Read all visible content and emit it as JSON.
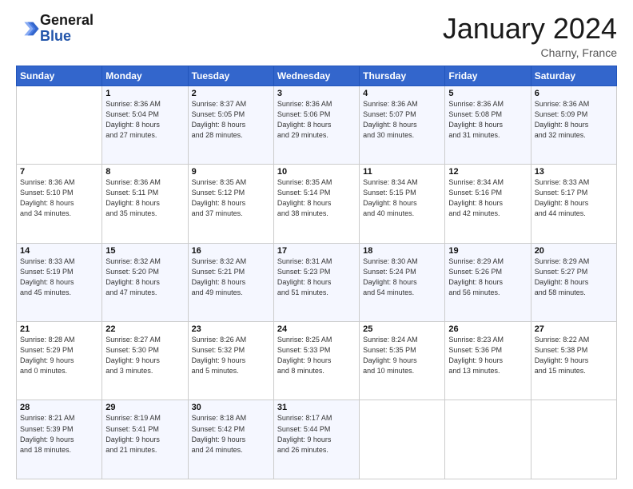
{
  "logo": {
    "line1": "General",
    "line2": "Blue"
  },
  "header": {
    "title": "January 2024",
    "subtitle": "Charny, France"
  },
  "days_of_week": [
    "Sunday",
    "Monday",
    "Tuesday",
    "Wednesday",
    "Thursday",
    "Friday",
    "Saturday"
  ],
  "weeks": [
    [
      {
        "day": "",
        "info": ""
      },
      {
        "day": "1",
        "info": "Sunrise: 8:36 AM\nSunset: 5:04 PM\nDaylight: 8 hours\nand 27 minutes."
      },
      {
        "day": "2",
        "info": "Sunrise: 8:37 AM\nSunset: 5:05 PM\nDaylight: 8 hours\nand 28 minutes."
      },
      {
        "day": "3",
        "info": "Sunrise: 8:36 AM\nSunset: 5:06 PM\nDaylight: 8 hours\nand 29 minutes."
      },
      {
        "day": "4",
        "info": "Sunrise: 8:36 AM\nSunset: 5:07 PM\nDaylight: 8 hours\nand 30 minutes."
      },
      {
        "day": "5",
        "info": "Sunrise: 8:36 AM\nSunset: 5:08 PM\nDaylight: 8 hours\nand 31 minutes."
      },
      {
        "day": "6",
        "info": "Sunrise: 8:36 AM\nSunset: 5:09 PM\nDaylight: 8 hours\nand 32 minutes."
      }
    ],
    [
      {
        "day": "7",
        "info": "Sunrise: 8:36 AM\nSunset: 5:10 PM\nDaylight: 8 hours\nand 34 minutes."
      },
      {
        "day": "8",
        "info": "Sunrise: 8:36 AM\nSunset: 5:11 PM\nDaylight: 8 hours\nand 35 minutes."
      },
      {
        "day": "9",
        "info": "Sunrise: 8:35 AM\nSunset: 5:12 PM\nDaylight: 8 hours\nand 37 minutes."
      },
      {
        "day": "10",
        "info": "Sunrise: 8:35 AM\nSunset: 5:14 PM\nDaylight: 8 hours\nand 38 minutes."
      },
      {
        "day": "11",
        "info": "Sunrise: 8:34 AM\nSunset: 5:15 PM\nDaylight: 8 hours\nand 40 minutes."
      },
      {
        "day": "12",
        "info": "Sunrise: 8:34 AM\nSunset: 5:16 PM\nDaylight: 8 hours\nand 42 minutes."
      },
      {
        "day": "13",
        "info": "Sunrise: 8:33 AM\nSunset: 5:17 PM\nDaylight: 8 hours\nand 44 minutes."
      }
    ],
    [
      {
        "day": "14",
        "info": "Sunrise: 8:33 AM\nSunset: 5:19 PM\nDaylight: 8 hours\nand 45 minutes."
      },
      {
        "day": "15",
        "info": "Sunrise: 8:32 AM\nSunset: 5:20 PM\nDaylight: 8 hours\nand 47 minutes."
      },
      {
        "day": "16",
        "info": "Sunrise: 8:32 AM\nSunset: 5:21 PM\nDaylight: 8 hours\nand 49 minutes."
      },
      {
        "day": "17",
        "info": "Sunrise: 8:31 AM\nSunset: 5:23 PM\nDaylight: 8 hours\nand 51 minutes."
      },
      {
        "day": "18",
        "info": "Sunrise: 8:30 AM\nSunset: 5:24 PM\nDaylight: 8 hours\nand 54 minutes."
      },
      {
        "day": "19",
        "info": "Sunrise: 8:29 AM\nSunset: 5:26 PM\nDaylight: 8 hours\nand 56 minutes."
      },
      {
        "day": "20",
        "info": "Sunrise: 8:29 AM\nSunset: 5:27 PM\nDaylight: 8 hours\nand 58 minutes."
      }
    ],
    [
      {
        "day": "21",
        "info": "Sunrise: 8:28 AM\nSunset: 5:29 PM\nDaylight: 9 hours\nand 0 minutes."
      },
      {
        "day": "22",
        "info": "Sunrise: 8:27 AM\nSunset: 5:30 PM\nDaylight: 9 hours\nand 3 minutes."
      },
      {
        "day": "23",
        "info": "Sunrise: 8:26 AM\nSunset: 5:32 PM\nDaylight: 9 hours\nand 5 minutes."
      },
      {
        "day": "24",
        "info": "Sunrise: 8:25 AM\nSunset: 5:33 PM\nDaylight: 9 hours\nand 8 minutes."
      },
      {
        "day": "25",
        "info": "Sunrise: 8:24 AM\nSunset: 5:35 PM\nDaylight: 9 hours\nand 10 minutes."
      },
      {
        "day": "26",
        "info": "Sunrise: 8:23 AM\nSunset: 5:36 PM\nDaylight: 9 hours\nand 13 minutes."
      },
      {
        "day": "27",
        "info": "Sunrise: 8:22 AM\nSunset: 5:38 PM\nDaylight: 9 hours\nand 15 minutes."
      }
    ],
    [
      {
        "day": "28",
        "info": "Sunrise: 8:21 AM\nSunset: 5:39 PM\nDaylight: 9 hours\nand 18 minutes."
      },
      {
        "day": "29",
        "info": "Sunrise: 8:19 AM\nSunset: 5:41 PM\nDaylight: 9 hours\nand 21 minutes."
      },
      {
        "day": "30",
        "info": "Sunrise: 8:18 AM\nSunset: 5:42 PM\nDaylight: 9 hours\nand 24 minutes."
      },
      {
        "day": "31",
        "info": "Sunrise: 8:17 AM\nSunset: 5:44 PM\nDaylight: 9 hours\nand 26 minutes."
      },
      {
        "day": "",
        "info": ""
      },
      {
        "day": "",
        "info": ""
      },
      {
        "day": "",
        "info": ""
      }
    ]
  ]
}
